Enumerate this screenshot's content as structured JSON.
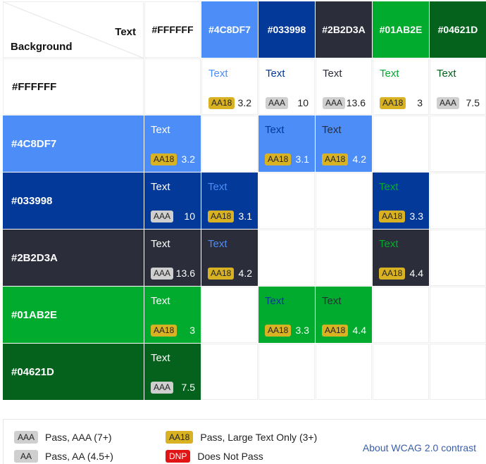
{
  "header": {
    "text_label": "Text",
    "background_label": "Background"
  },
  "colors": [
    "#FFFFFF",
    "#4C8DF7",
    "#033998",
    "#2B2D3A",
    "#01AB2E",
    "#04621D"
  ],
  "sample_text": "Text",
  "badge_styles": {
    "AAA": {
      "bg": "#cfcfcf",
      "fg": "#222222"
    },
    "AA": {
      "bg": "#cfcfcf",
      "fg": "#222222"
    },
    "AA18": {
      "bg": "#d8b223",
      "fg": "#222222"
    },
    "DNP": {
      "bg": "#e01414",
      "fg": "#ffffff"
    }
  },
  "rows": [
    {
      "bg": "#FFFFFF",
      "cells": [
        null,
        {
          "fg": "#4C8DF7",
          "rating": "AA18",
          "ratio": "3.2"
        },
        {
          "fg": "#033998",
          "rating": "AAA",
          "ratio": "10"
        },
        {
          "fg": "#2B2D3A",
          "rating": "AAA",
          "ratio": "13.6"
        },
        {
          "fg": "#01AB2E",
          "rating": "AA18",
          "ratio": "3"
        },
        {
          "fg": "#04621D",
          "rating": "AAA",
          "ratio": "7.5"
        }
      ]
    },
    {
      "bg": "#4C8DF7",
      "cells": [
        {
          "fg": "#FFFFFF",
          "rating": "AA18",
          "ratio": "3.2"
        },
        null,
        {
          "fg": "#033998",
          "rating": "AA18",
          "ratio": "3.1"
        },
        {
          "fg": "#2B2D3A",
          "rating": "AA18",
          "ratio": "4.2"
        },
        null,
        null
      ]
    },
    {
      "bg": "#033998",
      "cells": [
        {
          "fg": "#FFFFFF",
          "rating": "AAA",
          "ratio": "10"
        },
        {
          "fg": "#4C8DF7",
          "rating": "AA18",
          "ratio": "3.1"
        },
        null,
        null,
        {
          "fg": "#01AB2E",
          "rating": "AA18",
          "ratio": "3.3"
        },
        null
      ]
    },
    {
      "bg": "#2B2D3A",
      "cells": [
        {
          "fg": "#FFFFFF",
          "rating": "AAA",
          "ratio": "13.6"
        },
        {
          "fg": "#4C8DF7",
          "rating": "AA18",
          "ratio": "4.2"
        },
        null,
        null,
        {
          "fg": "#01AB2E",
          "rating": "AA18",
          "ratio": "4.4"
        },
        null
      ]
    },
    {
      "bg": "#01AB2E",
      "cells": [
        {
          "fg": "#FFFFFF",
          "rating": "AA18",
          "ratio": "3"
        },
        null,
        {
          "fg": "#033998",
          "rating": "AA18",
          "ratio": "3.3"
        },
        {
          "fg": "#2B2D3A",
          "rating": "AA18",
          "ratio": "4.4"
        },
        null,
        null
      ]
    },
    {
      "bg": "#04621D",
      "cells": [
        {
          "fg": "#FFFFFF",
          "rating": "AAA",
          "ratio": "7.5"
        },
        null,
        null,
        null,
        null,
        null
      ]
    }
  ],
  "legend": {
    "aaa": {
      "badge": "AAA",
      "label": "Pass, AAA (7+)"
    },
    "aa": {
      "badge": "AA",
      "label": "Pass, AA (4.5+)"
    },
    "aa18": {
      "badge": "AA18",
      "label": "Pass, Large Text Only (3+)"
    },
    "dnp": {
      "badge": "DNP",
      "label": "Does Not Pass"
    },
    "about_link": "About WCAG 2.0 contrast"
  }
}
